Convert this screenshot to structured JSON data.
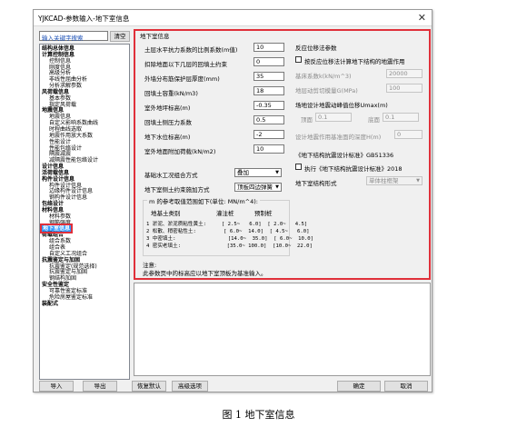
{
  "window": {
    "title": "YJKCAD-参数输入-地下室信息",
    "close_icon": "close-icon"
  },
  "search": {
    "placeholder": "输入关键字搜索",
    "clear_label": "清空"
  },
  "tree": [
    {
      "label": "结构总体信息",
      "level": 0
    },
    {
      "label": "计算控制信息",
      "level": 0
    },
    {
      "label": "控制信息",
      "level": 1
    },
    {
      "label": "刚度信息",
      "level": 1
    },
    {
      "label": "高级分析",
      "level": 1
    },
    {
      "label": "非线性屈曲分析",
      "level": 1
    },
    {
      "label": "分析求解参数",
      "level": 1
    },
    {
      "label": "风荷载信息",
      "level": 0
    },
    {
      "label": "基本参数",
      "level": 1
    },
    {
      "label": "指定风荷载",
      "level": 1
    },
    {
      "label": "地震信息",
      "level": 0
    },
    {
      "label": "地震信息",
      "level": 1
    },
    {
      "label": "自定义影响系数曲线",
      "level": 1
    },
    {
      "label": "时程曲线选取",
      "level": 1
    },
    {
      "label": "地震作用放大系数",
      "level": 1
    },
    {
      "label": "性能设计",
      "level": 1
    },
    {
      "label": "性能包络设计",
      "level": 1
    },
    {
      "label": "隔震减震",
      "level": 1
    },
    {
      "label": "减隔震性能包络设计",
      "level": 1
    },
    {
      "label": "设计信息",
      "level": 0
    },
    {
      "label": "活荷载信息",
      "level": 0
    },
    {
      "label": "构件设计信息",
      "level": 0
    },
    {
      "label": "构件设计信息",
      "level": 1
    },
    {
      "label": "边缘构件设计信息",
      "level": 1
    },
    {
      "label": "钢构件设计信息",
      "level": 1
    },
    {
      "label": "包络设计",
      "level": 0
    },
    {
      "label": "材料信息",
      "level": 0
    },
    {
      "label": "材料参数",
      "level": 1
    },
    {
      "label": "钢筋强度",
      "level": 1
    },
    {
      "label": "地下室信息",
      "level": 0,
      "selected": true
    },
    {
      "label": "荷载组合",
      "level": 0
    },
    {
      "label": "组合系数",
      "level": 1
    },
    {
      "label": "组合表",
      "level": 1
    },
    {
      "label": "自定义工况组合",
      "level": 1
    },
    {
      "label": "抗震鉴定与加固",
      "level": 0
    },
    {
      "label": "抗震鉴定(规范选择)",
      "level": 1
    },
    {
      "label": "抗震鉴定与加固",
      "level": 1
    },
    {
      "label": "钢结构加固",
      "level": 1
    },
    {
      "label": "安全性鉴定",
      "level": 0
    },
    {
      "label": "可靠性鉴定标准",
      "level": 1
    },
    {
      "label": "危险房屋鉴定标准",
      "level": 1
    },
    {
      "label": "装配式",
      "level": 0
    }
  ],
  "panel": {
    "title": "地下室信息",
    "left_fields": [
      {
        "label": "土层水平抗力系数的比例系数(m值)",
        "value": "10"
      },
      {
        "label": "扣除地面以下几层的回填土约束",
        "value": "0"
      },
      {
        "label": "外墙分布筋保护层厚度(mm)",
        "value": "35"
      },
      {
        "label": "回填土容重(kN/m3)",
        "value": "18"
      },
      {
        "label": "室外地坪标高(m)",
        "value": "-0.35"
      },
      {
        "label": "回填土侧压力系数",
        "value": "0.5"
      },
      {
        "label": "地下水位标高(m)",
        "value": "-2"
      },
      {
        "label": "室外地面附加荷载(kN/m2)",
        "value": "10"
      }
    ],
    "water_pressure": {
      "label": "基础水工况组合方式",
      "value": "叠加"
    },
    "wall_soil": {
      "label": "地下室侧土约束施加方式",
      "value": "顶板四边弹簧"
    },
    "reaction": {
      "title": "反应位移法参数",
      "check_label": "按反应位移法计算地下结构的地震作用",
      "f1_label": "基床系数k(kN/m^3)",
      "f1_value": "20000",
      "f2_label": "地层动剪切模量G(MPa)",
      "f2_value": "100",
      "site_label": "场地设计地震动峰值位移Umax(m)",
      "top_label": "顶面",
      "top_value": "0.1",
      "bottom_label": "底面",
      "bottom_value": "0.1",
      "depth_label": "设计地震作用基准面的深度H(m)",
      "depth_value": "0"
    },
    "gb": {
      "title": "《地下结构抗震设计标准》GB51336",
      "check_label": "执行《地下结构抗震设计标准》2018",
      "type_label": "地下室结构形式",
      "type_value": "单体柱框架"
    },
    "ref": {
      "title": "m 的参考取值范围如下(单位: MN/m^4):",
      "headers": [
        "地基土类别",
        "灌注桩",
        "预制桩"
      ],
      "rows": [
        "1 淤泥、淤泥质粘性黄土:     [ 2.5~   6.0]  [ 2.0~   4.5]",
        "2 松散、稍密粘性土:         [ 6.0~  14.0]  [ 4.5~   6.0]",
        "3 中密填土:                 [14.0~  35.0]  [ 6.0~  10.0]",
        "4 密实老填土:               [35.0~ 100.0]  [10.0~  22.0]"
      ]
    },
    "note_title": "注意:",
    "note_text": "此参数页中的标高应以地下室顶板为基准输入。"
  },
  "footer": {
    "import": "导入",
    "export": "导出",
    "restore": "恢复默认",
    "advanced": "高级选项",
    "ok": "确定",
    "cancel": "取消"
  },
  "caption": "图 1   地下室信息"
}
